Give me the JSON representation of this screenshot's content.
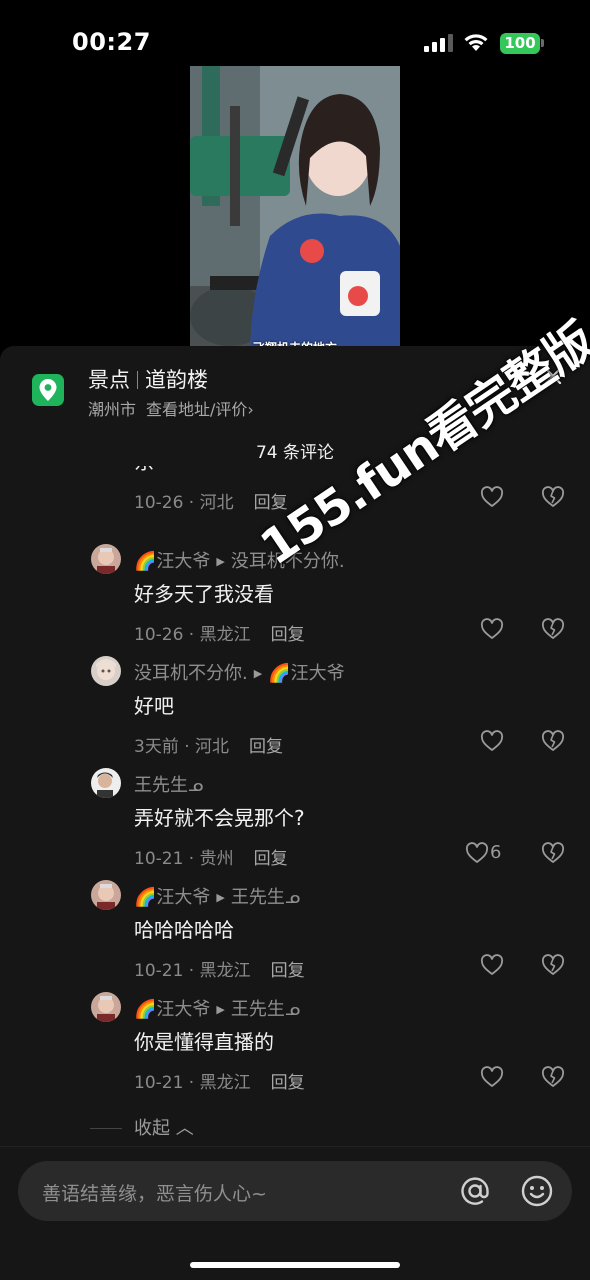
{
  "status_bar": {
    "time": "00:27",
    "battery": "100"
  },
  "video": {
    "caption": "飞翔机夫的地方"
  },
  "poi": {
    "category": "景点",
    "name": "道韵楼",
    "city": "潮州市",
    "action": "查看地址/评价",
    "chevron": "›"
  },
  "comments_header": {
    "count_label": "74 条评论"
  },
  "partial_comment": {
    "text_fragment": "东",
    "date_location": "10-26 · 河北",
    "reply": "回复"
  },
  "comments": [
    {
      "author": "🌈汪大爷",
      "reply_to": "没耳机不分你.",
      "text": "好多天了我没看",
      "date_location": "10-26 · 黑龙江",
      "reply": "回复",
      "likes": ""
    },
    {
      "author": "没耳机不分你.",
      "reply_to": "🌈汪大爷",
      "text": "好吧",
      "date_location": "3天前 · 河北",
      "reply": "回复",
      "likes": ""
    },
    {
      "author": "王先生ᓄ",
      "reply_to": "",
      "text": "弄好就不会晃那个?",
      "date_location": "10-21 · 贵州",
      "reply": "回复",
      "likes": "6"
    },
    {
      "author": "🌈汪大爷",
      "reply_to": "王先生ᓄ",
      "text": "哈哈哈哈哈",
      "date_location": "10-21 · 黑龙江",
      "reply": "回复",
      "likes": ""
    },
    {
      "author": "🌈汪大爷",
      "reply_to": "王先生ᓄ",
      "text": "你是懂得直播的",
      "date_location": "10-21 · 黑龙江",
      "reply": "回复",
      "likes": ""
    }
  ],
  "collapse_label": "收起",
  "input": {
    "placeholder": "善语结善缘，恶言伤人心~"
  },
  "watermark": "155.fun看完整版",
  "colors": {
    "accent_green": "#1fb45c",
    "battery_green": "#34c759",
    "panel_bg": "#161616"
  },
  "icons": [
    "signal-icon",
    "wifi-icon",
    "location-pin-icon",
    "close-icon",
    "heart-icon",
    "broken-heart-icon",
    "at-icon",
    "emoji-icon"
  ]
}
